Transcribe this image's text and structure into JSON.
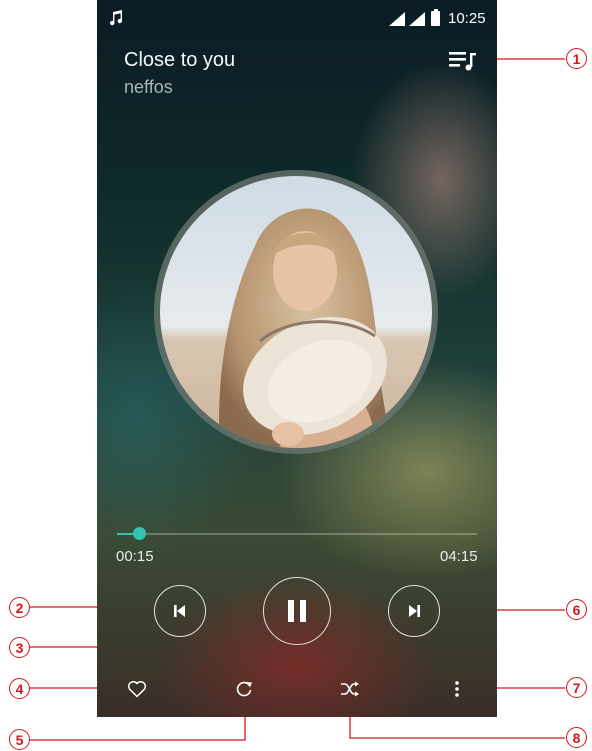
{
  "status_bar": {
    "time": "10:25",
    "music_icon": "music-note-icon",
    "signal_icon": "cell-signal-icon",
    "battery_icon": "battery-icon"
  },
  "now_playing": {
    "title": "Close to you",
    "artist": "neffos"
  },
  "playlist_icon": "playlist-icon",
  "album_art": {
    "description_icon": "album-art"
  },
  "playback": {
    "elapsed": "00:15",
    "total": "04:15",
    "progress": 0.06
  },
  "controls": {
    "previous": "previous-track-icon",
    "pause": "pause-icon",
    "next": "next-track-icon"
  },
  "bottom_bar": {
    "favorite": "heart-icon",
    "repeat": "repeat-icon",
    "shuffle": "shuffle-icon",
    "more": "more-vertical-icon"
  },
  "callouts": [
    "1",
    "2",
    "3",
    "4",
    "5",
    "6",
    "7",
    "8"
  ],
  "colors": {
    "accent": "#33c3b0",
    "callout": "#d9161d"
  }
}
